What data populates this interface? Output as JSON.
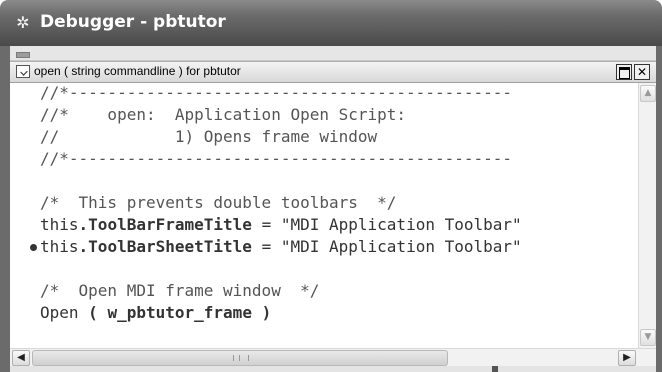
{
  "window": {
    "title": "Debugger - pbtutor",
    "icon": "debugger-icon"
  },
  "child_window": {
    "caption": "open ( string commandline ) for pbtutor",
    "icon": "script-icon",
    "close_label": "✕"
  },
  "code": {
    "lines": [
      "//*----------------------------------------------",
      "//*    open:  Application Open Script:",
      "//            1) Opens frame window",
      "//*----------------------------------------------",
      "/*  This prevents double toolbars  */",
      "this.ToolBarFrameTitle = \"MDI Application Toolbar\"",
      "this.ToolBarSheetTitle = \"MDI Application Toolbar\"",
      "/*  Open MDI frame window  */",
      "Open ( w_pbtutor_frame )"
    ],
    "breakpoint_line": 7
  },
  "scrollbars": {
    "up_arrow": "▲",
    "down_arrow": "▼",
    "left_arrow": "◀",
    "right_arrow": "▶"
  }
}
